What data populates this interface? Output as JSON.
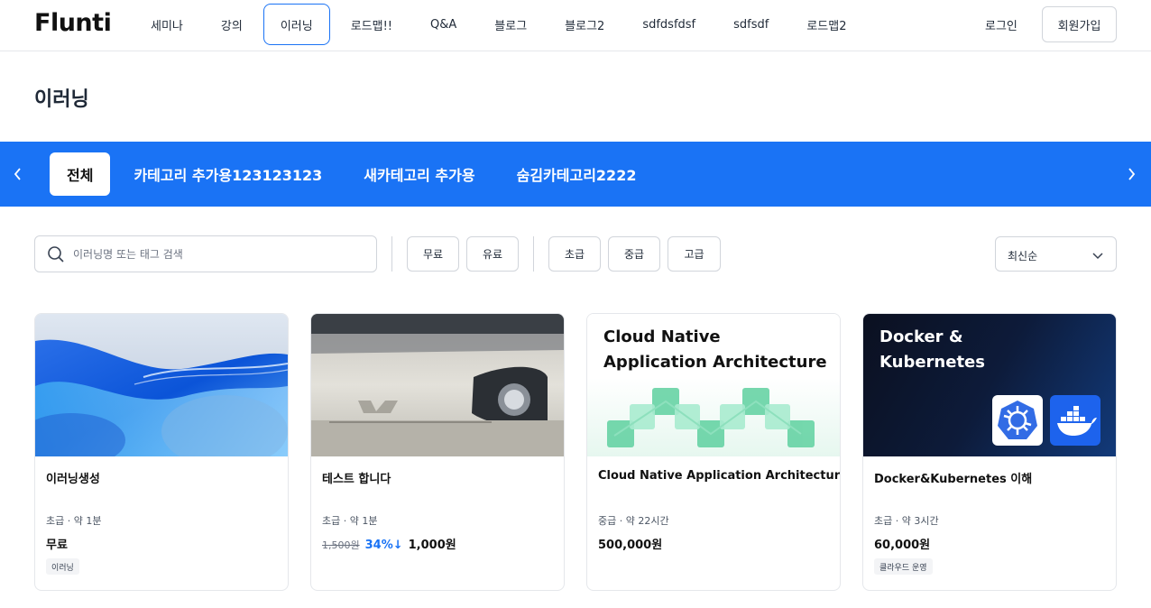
{
  "header": {
    "logo": "Flunti",
    "nav": [
      "세미나",
      "강의",
      "이러닝",
      "로드맵!!",
      "Q&A",
      "블로그",
      "블로그2",
      "sdfdsfdsf",
      "sdfsdf",
      "로드맵2"
    ],
    "active_nav": "이러닝",
    "login": "로그인",
    "signup": "회원가입"
  },
  "page_title": "이러닝",
  "categories": [
    "전체",
    "카테고리 추가용123123123",
    "새카테고리 추가용",
    "숨김카테고리2222"
  ],
  "filters": {
    "search_placeholder": "이러닝명 또는 태그 검색",
    "price": [
      "무료",
      "유료"
    ],
    "level": [
      "초급",
      "중급",
      "고급"
    ],
    "sort": "최신순"
  },
  "colors": {
    "accent": "#1a73f5",
    "border": "#e5e7eb"
  },
  "cards": [
    {
      "title": "이러닝생성",
      "meta": "초급 · 약 1분",
      "original_price": "",
      "discount": "",
      "price": "무료",
      "tag": "이러닝",
      "thumb_text": ""
    },
    {
      "title": "테스트 합니다",
      "meta": "초급 · 약 1분",
      "original_price": "1,500원",
      "discount": "34%↓",
      "price": "1,000원",
      "tag": "",
      "thumb_text": ""
    },
    {
      "title": "Cloud Native Application Architecture",
      "meta": "중급 · 약 22시간",
      "original_price": "",
      "discount": "",
      "price": "500,000원",
      "tag": "",
      "thumb_text": "Cloud Native\nApplication Architecture"
    },
    {
      "title": "Docker&Kubernetes 이해",
      "meta": "초급 · 약 3시간",
      "original_price": "",
      "discount": "",
      "price": "60,000원",
      "tag": "클라우드 운영",
      "thumb_text": "Docker &\nKubernetes"
    }
  ]
}
